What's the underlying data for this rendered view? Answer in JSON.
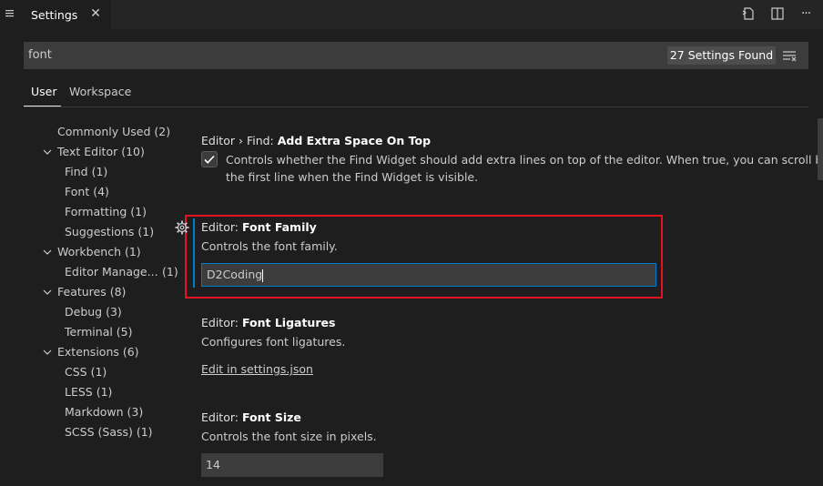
{
  "tab": {
    "title": "Settings",
    "close_glyph": "✕"
  },
  "toolbar": {
    "open_json_icon": "open-settings-json-icon",
    "split_icon": "split-editor-icon",
    "more_label": "···"
  },
  "search": {
    "value": "font",
    "results_count": "27 Settings Found"
  },
  "scopes": {
    "user": "User",
    "workspace": "Workspace"
  },
  "toc": [
    {
      "label": "Commonly Used (2)"
    },
    {
      "label": "Text Editor (10)"
    },
    {
      "label": "Find (1)"
    },
    {
      "label": "Font (4)"
    },
    {
      "label": "Formatting (1)"
    },
    {
      "label": "Suggestions (1)"
    },
    {
      "label": "Workbench (1)"
    },
    {
      "label": "Editor Manage...",
      "count": "(1)"
    },
    {
      "label": "Features (8)"
    },
    {
      "label": "Debug (3)"
    },
    {
      "label": "Terminal (5)"
    },
    {
      "label": "Extensions (6)"
    },
    {
      "label": "CSS (1)"
    },
    {
      "label": "LESS (1)"
    },
    {
      "label": "Markdown (3)"
    },
    {
      "label": "SCSS (Sass) (1)"
    }
  ],
  "settings": {
    "find_extra_space": {
      "category": "Editor › Find: ",
      "name": "Add Extra Space On Top",
      "desc_line1": "Controls whether the Find Widget should add extra lines on top of the editor. When true, you can scroll beyond",
      "desc_line2": "the first line when the Find Widget is visible.",
      "checked": true
    },
    "font_family": {
      "category": "Editor: ",
      "name": "Font Family",
      "desc": "Controls the font family.",
      "value": "D2Coding"
    },
    "font_ligatures": {
      "category": "Editor: ",
      "name": "Font Ligatures",
      "desc": "Configures font ligatures.",
      "link": "Edit in settings.json"
    },
    "font_size": {
      "category": "Editor: ",
      "name": "Font Size",
      "desc": "Controls the font size in pixels.",
      "value": "14"
    }
  },
  "colors": {
    "accent": "#007acc",
    "highlight": "#e81123",
    "background": "#1e1e1e"
  }
}
